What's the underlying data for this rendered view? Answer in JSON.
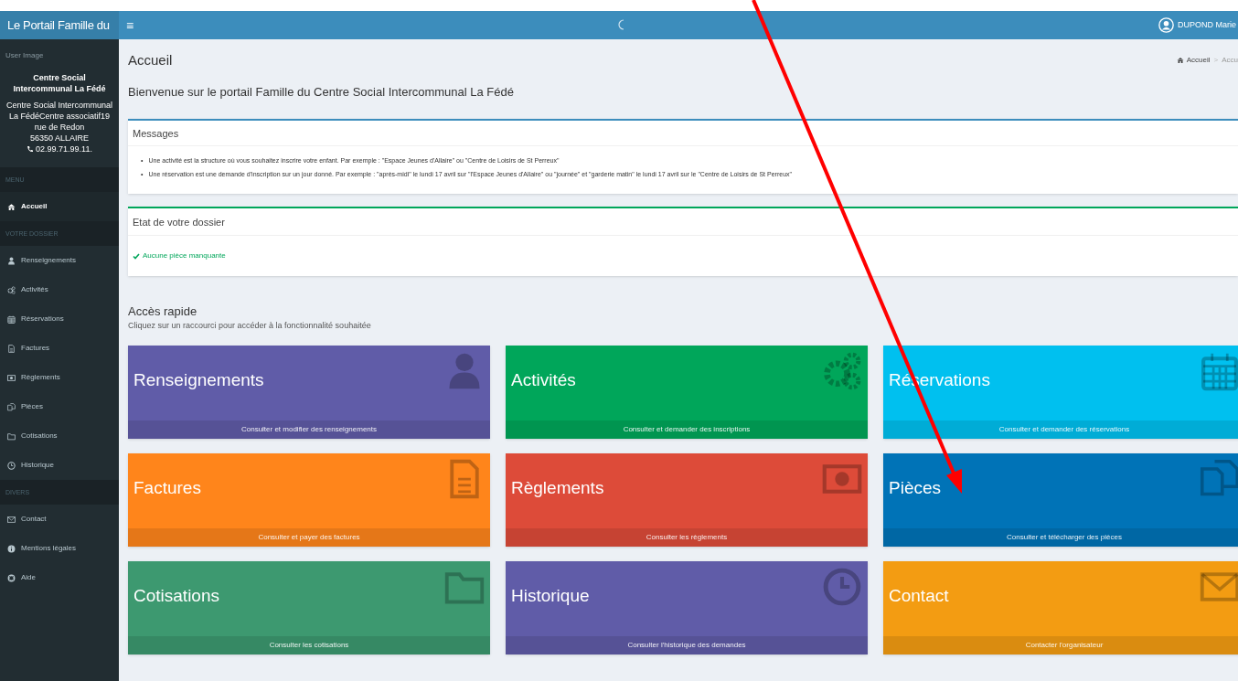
{
  "header": {
    "logo": "Le Portail Famille du",
    "menu_toggle": "≡",
    "user": "DUPOND Marie"
  },
  "sidebar": {
    "user_image_alt": "User Image",
    "org_name": "Centre Social Intercommunal La Fédé",
    "address": [
      "Centre Social Intercommunal La FédéCentre associatif19 rue de Redon",
      "56350 ALLAIRE"
    ],
    "phone": "02.99.71.99.11.",
    "sections": [
      {
        "header": "MENU",
        "items": [
          {
            "label": "Accueil",
            "kind": "home",
            "selected": true
          }
        ]
      },
      {
        "header": "VOTRE DOSSIER",
        "items": [
          {
            "label": "Renseignements",
            "kind": "user",
            "selected": false
          },
          {
            "label": "Activités",
            "kind": "gears",
            "selected": false
          },
          {
            "label": "Réservations",
            "kind": "calendar",
            "selected": false
          },
          {
            "label": "Factures",
            "kind": "file",
            "selected": false
          },
          {
            "label": "Règlements",
            "kind": "money",
            "selected": false
          },
          {
            "label": "Pièces",
            "kind": "files",
            "selected": false
          },
          {
            "label": "Cotisations",
            "kind": "folder",
            "selected": false
          },
          {
            "label": "Historique",
            "kind": "clock",
            "selected": false
          }
        ]
      },
      {
        "header": "DIVERS",
        "items": [
          {
            "label": "Contact",
            "kind": "mail",
            "selected": false
          },
          {
            "label": "Mentions légales",
            "kind": "info",
            "selected": false
          },
          {
            "label": "Aide",
            "kind": "help",
            "selected": false
          }
        ]
      }
    ]
  },
  "page": {
    "title": "Accueil",
    "breadcrumb": [
      "Accueil",
      "Accu"
    ],
    "breadcrumb_separator": ">",
    "welcome": "Bienvenue sur le portail Famille du Centre Social Intercommunal La Fédé"
  },
  "messages": {
    "title": "Messages",
    "bullet": "•",
    "items": [
      "Une activité est la structure où vous souhaitez inscrire votre enfant. Par exemple : \"Espace Jeunes d'Allaire\" ou \"Centre de Loisirs de St Perreux\"",
      "Une réservation est une demande d'inscription sur un jour donné. Par exemple : \"après-midi\" le lundi 17 avril sur \"l'Espace Jeunes d'Allaire\" ou \"journée\" et \"garderie matin\" le lundi 17 avril sur le \"Centre de Loisirs de St Perreux\""
    ]
  },
  "dossier": {
    "title": "Etat de votre dossier",
    "status": "Aucune pièce manquante"
  },
  "quick_access": {
    "title": "Accès rapide",
    "subtitle": "Cliquez sur un raccourci pour accéder à la fonctionnalité souhaitée",
    "tiles": [
      {
        "title": "Renseignements",
        "footer": "Consulter et modifier des renseignements",
        "kind": "user",
        "color": "#605ca8"
      },
      {
        "title": "Activités",
        "footer": "Consulter et demander des inscriptions",
        "kind": "gears",
        "color": "#00a65a"
      },
      {
        "title": "Réservations",
        "footer": "Consulter et demander des réservations",
        "kind": "calendar",
        "color": "#00c0ef"
      },
      {
        "title": "Factures",
        "footer": "Consulter et payer des factures",
        "kind": "file",
        "color": "#ff851b"
      },
      {
        "title": "Règlements",
        "footer": "Consulter les règlements",
        "kind": "money",
        "color": "#dd4b39"
      },
      {
        "title": "Pièces",
        "footer": "Consulter et télécharger des pièces",
        "kind": "files",
        "color": "#0073b7"
      },
      {
        "title": "Cotisations",
        "footer": "Consulter les cotisations",
        "kind": "folder",
        "color": "#3d9970"
      },
      {
        "title": "Historique",
        "footer": "Consulter l'historique des demandes",
        "kind": "clock",
        "color": "#605ca8"
      },
      {
        "title": "Contact",
        "footer": "Contacter l'organisateur",
        "kind": "mail",
        "color": "#f39c12"
      }
    ]
  }
}
